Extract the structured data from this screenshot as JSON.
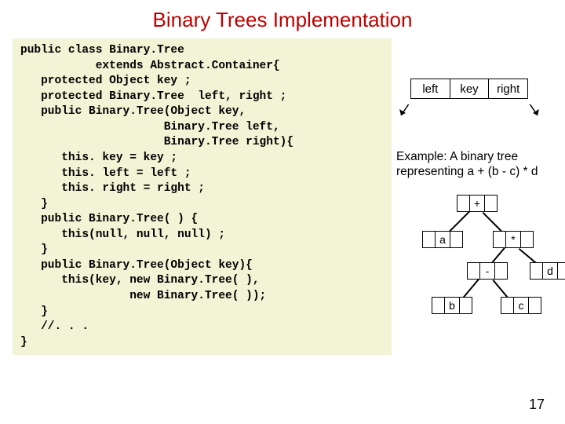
{
  "title": "Binary Trees Implementation",
  "code": "public class Binary.Tree\n           extends Abstract.Container{\n   protected Object key ;\n   protected Binary.Tree  left, right ;\n   public Binary.Tree(Object key,\n                     Binary.Tree left,\n                     Binary.Tree right){\n      this. key = key ;\n      this. left = left ;\n      this. right = right ;\n   }\n   public Binary.Tree( ) {\n      this(null, null, null) ;\n   }\n   public Binary.Tree(Object key){\n      this(key, new Binary.Tree( ),\n                new Binary.Tree( ));\n   }\n   //. . .\n}",
  "node": {
    "left": "left",
    "key": "key",
    "right": "right"
  },
  "caption": "Example: A binary tree representing a + (b - c) * d",
  "tree": {
    "plus": "+",
    "a": "a",
    "star": "*",
    "minus": "-",
    "d": "d",
    "b": "b",
    "c": "c"
  },
  "page": "17"
}
